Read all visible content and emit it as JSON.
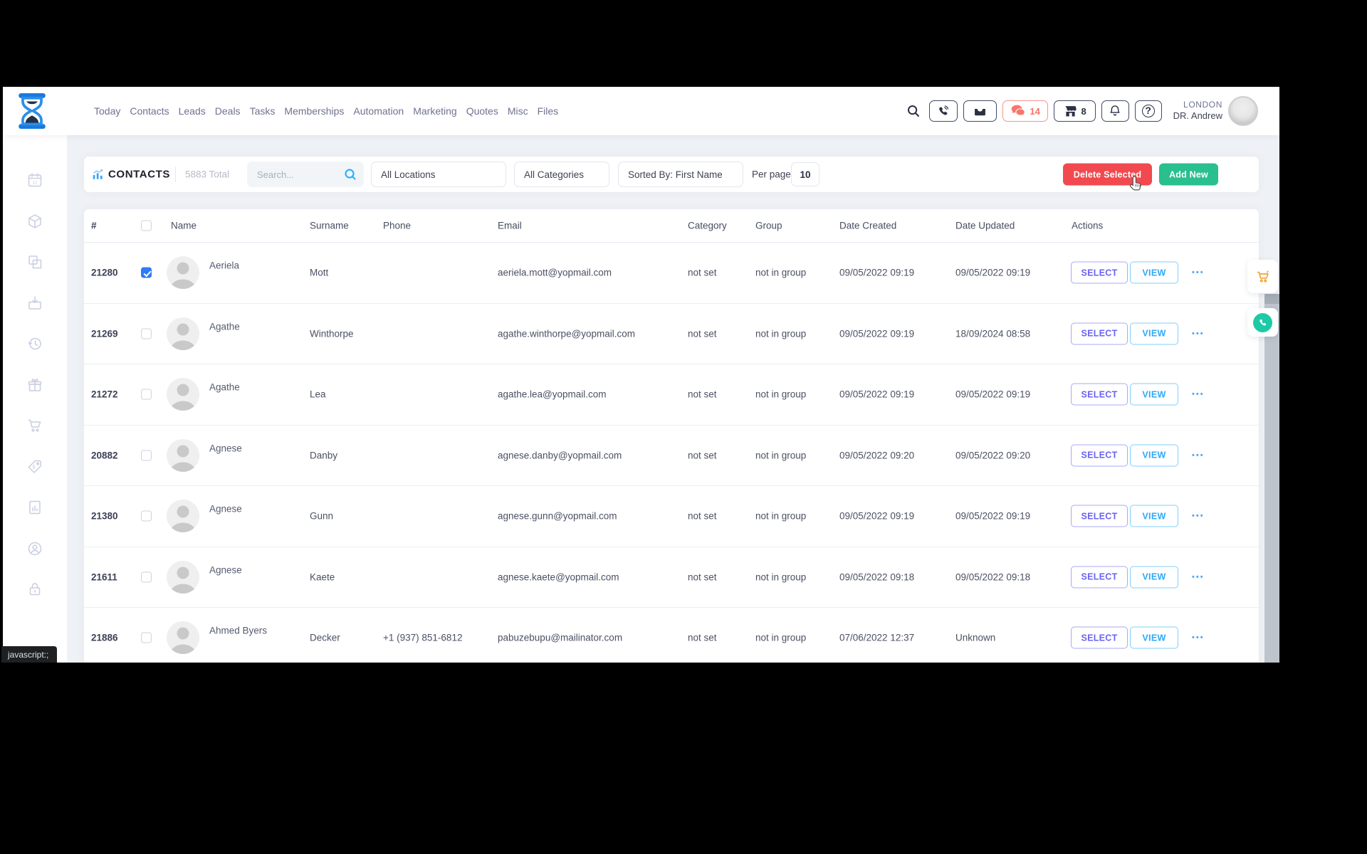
{
  "nav": {
    "items": [
      "Today",
      "Contacts",
      "Leads",
      "Deals",
      "Tasks",
      "Memberships",
      "Automation",
      "Marketing",
      "Quotes",
      "Misc",
      "Files"
    ],
    "chat_count": "14",
    "store_count": "8",
    "location": "LONDON",
    "user": "DR. Andrew"
  },
  "sidebar": {
    "icons": [
      "calendar-icon",
      "package-icon",
      "copy-icon",
      "archive-download-icon",
      "history-icon",
      "gift-icon",
      "cart-icon",
      "price-tag-icon",
      "report-icon",
      "account-icon",
      "lock-icon"
    ]
  },
  "toolbar": {
    "title": "CONTACTS",
    "total": "5883 Total",
    "search_placeholder": "Search...",
    "locations_filter": "All Locations",
    "categories_filter": "All Categories",
    "sorted_by": "Sorted By: First Name",
    "per_page_label": "Per page",
    "per_page_value": "10",
    "delete_label": "Delete Selected",
    "add_label": "Add New"
  },
  "table": {
    "headers": {
      "id": "#",
      "name": "Name",
      "surname": "Surname",
      "phone": "Phone",
      "email": "Email",
      "category": "Category",
      "group": "Group",
      "created": "Date Created",
      "updated": "Date Updated",
      "actions": "Actions"
    },
    "select_label": "SELECT",
    "view_label": "VIEW",
    "rows": [
      {
        "id": "21280",
        "checked": true,
        "name": "Aeriela",
        "surname": "Mott",
        "phone": "",
        "email": "aeriela.mott@yopmail.com",
        "category": "not set",
        "group": "not in group",
        "created": "09/05/2022 09:19",
        "updated": "09/05/2022 09:19"
      },
      {
        "id": "21269",
        "checked": false,
        "name": "Agathe",
        "surname": "Winthorpe",
        "phone": "",
        "email": "agathe.winthorpe@yopmail.com",
        "category": "not set",
        "group": "not in group",
        "created": "09/05/2022 09:19",
        "updated": "18/09/2024 08:58"
      },
      {
        "id": "21272",
        "checked": false,
        "name": "Agathe",
        "surname": "Lea",
        "phone": "",
        "email": "agathe.lea@yopmail.com",
        "category": "not set",
        "group": "not in group",
        "created": "09/05/2022 09:19",
        "updated": "09/05/2022 09:19"
      },
      {
        "id": "20882",
        "checked": false,
        "name": "Agnese",
        "surname": "Danby",
        "phone": "",
        "email": "agnese.danby@yopmail.com",
        "category": "not set",
        "group": "not in group",
        "created": "09/05/2022 09:20",
        "updated": "09/05/2022 09:20"
      },
      {
        "id": "21380",
        "checked": false,
        "name": "Agnese",
        "surname": "Gunn",
        "phone": "",
        "email": "agnese.gunn@yopmail.com",
        "category": "not set",
        "group": "not in group",
        "created": "09/05/2022 09:19",
        "updated": "09/05/2022 09:19"
      },
      {
        "id": "21611",
        "checked": false,
        "name": "Agnese",
        "surname": "Kaete",
        "phone": "",
        "email": "agnese.kaete@yopmail.com",
        "category": "not set",
        "group": "not in group",
        "created": "09/05/2022 09:18",
        "updated": "09/05/2022 09:18"
      },
      {
        "id": "21886",
        "checked": false,
        "name": "Ahmed Byers",
        "surname": "Decker",
        "phone": "+1 (937) 851-6812",
        "email": "pabuzebupu@mailinator.com",
        "category": "not set",
        "group": "not in group",
        "created": "07/06/2022 12:37",
        "updated": "Unknown"
      }
    ]
  },
  "status": {
    "tooltip": "javascript:;"
  },
  "colors": {
    "delete_red": "#f1494f",
    "add_green": "#2abf8e",
    "accent_blue": "#3699ff",
    "select_purple": "#6a63f2",
    "view_blue": "#2ea9f7",
    "chat_red": "#f8716a",
    "cart_orange": "#f2a33c",
    "whatsapp_teal": "#1ec9a6"
  }
}
